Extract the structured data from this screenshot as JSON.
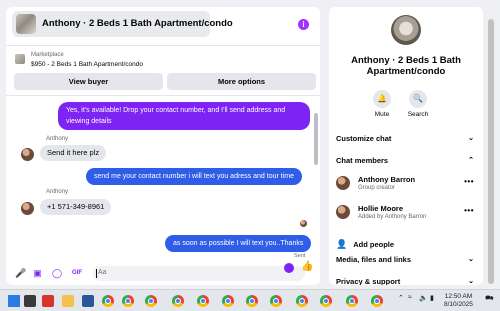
{
  "chat": {
    "title": "Anthony · 2 Beds 1 Bath Apartment/condo",
    "marketplace_label": "Marketplace",
    "listing": "$950 - 2 Beds 1 Bath Apartment/condo",
    "view_buyer": "View buyer",
    "more_options": "More options",
    "messages": [
      {
        "from": "me",
        "text_line1": "Yes, it's available! Drop your contact number, and I'll send address and",
        "text_line2": "viewing details"
      },
      {
        "from": "Anthony",
        "sender": "Anthony",
        "text": "Send it here plz"
      },
      {
        "from": "me",
        "text": "send me your contact number i will text you adress and tour time"
      },
      {
        "from": "Anthony",
        "sender": "Anthony",
        "text": "+1 571-349-8961"
      },
      {
        "from": "me",
        "text": "as soon as possible I will text you..Thanks"
      }
    ],
    "sent_label": "Sent",
    "compose_placeholder": "Aa"
  },
  "info": {
    "title_line1": "Anthony · 2 Beds 1 Bath",
    "title_line2": "Apartment/condo",
    "mute": "Mute",
    "search": "Search",
    "customize_chat": "Customize chat",
    "chat_members": "Chat members",
    "members": [
      {
        "name": "Anthony Barron",
        "role": "Group creator"
      },
      {
        "name": "Hollie Moore",
        "role": "Added by Anthony Barron"
      }
    ],
    "add_people": "Add people",
    "media_files_links": "Media, files and links",
    "privacy_support": "Privacy & support"
  },
  "taskbar": {
    "time": "12:50 AM",
    "date": "8/10/2025"
  },
  "colors": {
    "accent": "#7d24f5",
    "blue_bubble": "#2f5de8"
  }
}
